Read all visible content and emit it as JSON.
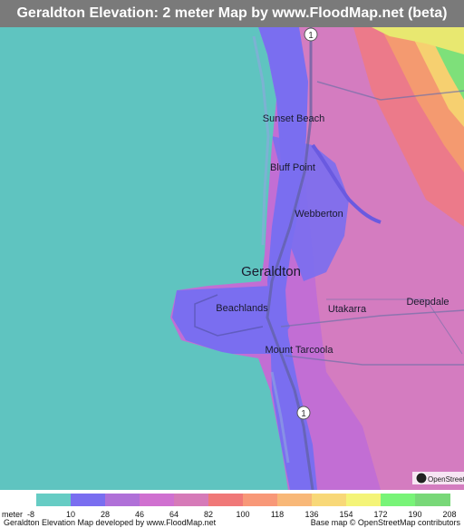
{
  "header": {
    "title": "Geraldton Elevation: 2 meter Map by www.FloodMap.net (beta)"
  },
  "map": {
    "places": [
      {
        "id": "sunset-beach",
        "name": "Sunset Beach"
      },
      {
        "id": "bluff-point",
        "name": "Bluff Point"
      },
      {
        "id": "webberton",
        "name": "Webberton"
      },
      {
        "id": "geraldton",
        "name": "Geraldton"
      },
      {
        "id": "beachlands",
        "name": "Beachlands"
      },
      {
        "id": "utakarra",
        "name": "Utakarra"
      },
      {
        "id": "deepdale",
        "name": "Deepdale"
      },
      {
        "id": "mount-tarcoola",
        "name": "Mount Tarcoola"
      }
    ],
    "route_marker": "1",
    "osm_badge": "OpenStreetMap",
    "colors": {
      "sea": "#5fc4c0",
      "low": "#7a6ef0",
      "mid": "#c06ad0",
      "high": "#e07aa0",
      "peak": "#f07850"
    }
  },
  "legend": {
    "unit_label": "meter",
    "values": [
      "-8",
      "10",
      "28",
      "46",
      "64",
      "82",
      "100",
      "118",
      "136",
      "154",
      "172",
      "190",
      "208"
    ],
    "colors": [
      "#66ccc4",
      "#7a6ef0",
      "#b070d8",
      "#d070d0",
      "#d67ab8",
      "#f07878",
      "#f89878",
      "#f8b878",
      "#f8d878",
      "#f4f478",
      "#78f478",
      "#78d878"
    ],
    "credit_left": "Geraldton Elevation Map developed by www.FloodMap.net",
    "credit_right": "Base map © OpenStreetMap contributors"
  }
}
